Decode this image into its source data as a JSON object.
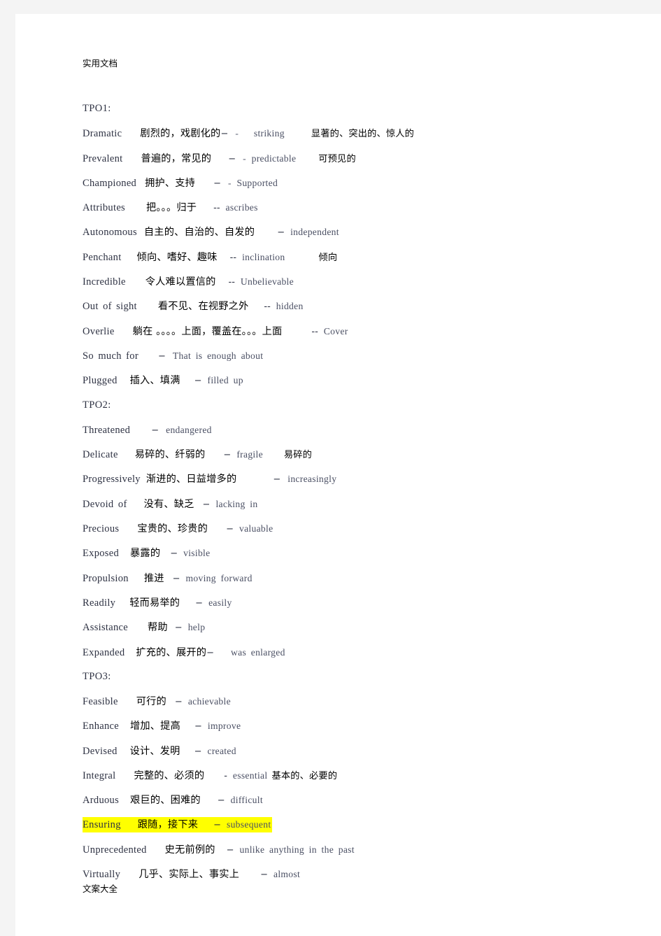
{
  "page": {
    "header_running_text": "实用文档",
    "footer_running_text": "文案大全",
    "background_color": "#f4f4f4",
    "paper_color": "#ffffff",
    "highlight_color": "#ffff00",
    "english_text_color": "#3b3f52",
    "chinese_text_color": "#000000"
  },
  "sections": [
    {
      "label": "TPO1:",
      "entries": [
        {
          "word": "Dramatic",
          "chinese": "剧烈的，戏剧化的",
          "dash": "−",
          "dash2": "-",
          "synonym": "striking",
          "chinese_trailing": "显著的、突出的、惊人的",
          "gap_after_word": 26,
          "gap_after_chinese": 0,
          "gap_after_dash": 22,
          "gap_after_syn": 38,
          "highlighted": false
        },
        {
          "word": "Prevalent",
          "chinese": "普遍的，常见的",
          "dash": "−",
          "dash2": "-",
          "synonym": "predictable",
          "chinese_trailing": "可预见的",
          "gap_after_word": 26,
          "gap_after_chinese": 24,
          "gap_after_dash": 8,
          "gap_after_syn": 32,
          "highlighted": false
        },
        {
          "word": "Championed",
          "chinese": "拥护、支持",
          "dash": "−",
          "dash2": "-",
          "synonym": "Supported",
          "chinese_trailing": "",
          "gap_after_word": 12,
          "gap_after_chinese": 26,
          "gap_after_dash": 8,
          "gap_after_syn": 0,
          "highlighted": false
        },
        {
          "word": "Attributes",
          "chinese": "把。。。归于",
          "dash": "--",
          "dash2": "",
          "synonym": "ascribes",
          "chinese_trailing": "",
          "gap_after_word": 30,
          "gap_after_chinese": 24,
          "gap_after_dash": 8,
          "gap_after_syn": 0,
          "highlighted": false
        },
        {
          "word": "Autonomous",
          "chinese": "自主的、自治的、自发的",
          "dash": "−",
          "dash2": "",
          "synonym": "independent",
          "chinese_trailing": "",
          "gap_after_word": 10,
          "gap_after_chinese": 32,
          "gap_after_dash": 8,
          "gap_after_syn": 0,
          "highlighted": false
        },
        {
          "word": "Penchant",
          "chinese": "倾向、嗜好、趣味",
          "dash": "--",
          "dash2": "",
          "synonym": "inclination",
          "chinese_trailing": "倾向",
          "gap_after_word": 22,
          "gap_after_chinese": 18,
          "gap_after_dash": 8,
          "gap_after_syn": 48,
          "highlighted": false
        },
        {
          "word": "Incredible",
          "chinese": "令人难以置信的",
          "dash": "--",
          "dash2": "",
          "synonym": "Unbelievable",
          "chinese_trailing": "",
          "gap_after_word": 28,
          "gap_after_chinese": 18,
          "gap_after_dash": 8,
          "gap_after_syn": 0,
          "highlighted": false
        },
        {
          "word": "Out of sight",
          "chinese": "看不见、在视野之外",
          "dash": "--",
          "dash2": "",
          "synonym": "hidden",
          "chinese_trailing": "",
          "gap_after_word": 30,
          "gap_after_chinese": 22,
          "gap_after_dash": 8,
          "gap_after_syn": 0,
          "highlighted": false
        },
        {
          "word": "Overlie",
          "chinese": "躺在 。。。。上面，覆盖在。。。上面",
          "dash": "--",
          "dash2": "",
          "synonym": "Cover",
          "chinese_trailing": "",
          "gap_after_word": 26,
          "gap_after_chinese": 42,
          "gap_after_dash": 8,
          "gap_after_syn": 0,
          "highlighted": false
        },
        {
          "word": "So much for",
          "chinese": "",
          "dash": "−",
          "dash2": "",
          "synonym": "That is enough about",
          "chinese_trailing": "",
          "gap_after_word": 28,
          "gap_after_chinese": 0,
          "gap_after_dash": 10,
          "gap_after_syn": 0,
          "highlighted": false
        },
        {
          "word": "Plugged",
          "chinese": "插入、填满",
          "dash": "−",
          "dash2": "",
          "synonym": "filled up",
          "chinese_trailing": "",
          "gap_after_word": 18,
          "gap_after_chinese": 20,
          "gap_after_dash": 8,
          "gap_after_syn": 0,
          "highlighted": false
        }
      ]
    },
    {
      "label": "TPO2:",
      "entries": [
        {
          "word": "Threatened",
          "chinese": "",
          "dash": "−",
          "dash2": "",
          "synonym": "endangered",
          "chinese_trailing": "",
          "gap_after_word": 30,
          "gap_after_chinese": 0,
          "gap_after_dash": 10,
          "gap_after_syn": 0,
          "highlighted": false
        },
        {
          "word": "Delicate",
          "chinese": "易碎的、纤弱的",
          "dash": "−",
          "dash2": "",
          "synonym": "fragile",
          "chinese_trailing": "易碎的",
          "gap_after_word": 24,
          "gap_after_chinese": 26,
          "gap_after_dash": 8,
          "gap_after_syn": 30,
          "highlighted": false
        },
        {
          "word": "Progressively",
          "chinese": "渐进的、日益增多的",
          "dash": "−",
          "dash2": "",
          "synonym": "increasingly",
          "chinese_trailing": "",
          "gap_after_word": 8,
          "gap_after_chinese": 52,
          "gap_after_dash": 10,
          "gap_after_syn": 0,
          "highlighted": false
        },
        {
          "word": "Devoid of",
          "chinese": "没有、缺乏",
          "dash": "−",
          "dash2": "",
          "synonym": "lacking in",
          "chinese_trailing": "",
          "gap_after_word": 24,
          "gap_after_chinese": 12,
          "gap_after_dash": 8,
          "gap_after_syn": 0,
          "highlighted": false
        },
        {
          "word": "Precious",
          "chinese": "宝贵的、珍贵的",
          "dash": "−",
          "dash2": "",
          "synonym": "valuable",
          "chinese_trailing": "",
          "gap_after_word": 26,
          "gap_after_chinese": 26,
          "gap_after_dash": 8,
          "gap_after_syn": 0,
          "highlighted": false
        },
        {
          "word": "Exposed",
          "chinese": "暴露的",
          "dash": "−",
          "dash2": "",
          "synonym": "visible",
          "chinese_trailing": "",
          "gap_after_word": 16,
          "gap_after_chinese": 14,
          "gap_after_dash": 8,
          "gap_after_syn": 0,
          "highlighted": false
        },
        {
          "word": "Propulsion",
          "chinese": "推进",
          "dash": "−",
          "dash2": "",
          "synonym": "moving forward",
          "chinese_trailing": "",
          "gap_after_word": 22,
          "gap_after_chinese": 12,
          "gap_after_dash": 8,
          "gap_after_syn": 0,
          "highlighted": false
        },
        {
          "word": "Readily",
          "chinese": "轻而易举的",
          "dash": "−",
          "dash2": "",
          "synonym": "easily",
          "chinese_trailing": "",
          "gap_after_word": 20,
          "gap_after_chinese": 22,
          "gap_after_dash": 8,
          "gap_after_syn": 0,
          "highlighted": false
        },
        {
          "word": "Assistance",
          "chinese": "帮助",
          "dash": "−",
          "dash2": "",
          "synonym": "help",
          "chinese_trailing": "",
          "gap_after_word": 28,
          "gap_after_chinese": 10,
          "gap_after_dash": 8,
          "gap_after_syn": 0,
          "highlighted": false
        },
        {
          "word": "Expanded",
          "chinese": "扩充的、展开的",
          "dash": "−",
          "dash2": "",
          "synonym": "was enlarged",
          "chinese_trailing": "",
          "gap_after_word": 16,
          "gap_after_chinese": 0,
          "gap_after_dash": 24,
          "gap_after_syn": 0,
          "highlighted": false
        }
      ]
    },
    {
      "label": "TPO3:",
      "entries": [
        {
          "word": "Feasible",
          "chinese": "可行的",
          "dash": "−",
          "dash2": "",
          "synonym": "achievable",
          "chinese_trailing": "",
          "gap_after_word": 26,
          "gap_after_chinese": 12,
          "gap_after_dash": 8,
          "gap_after_syn": 0,
          "highlighted": false
        },
        {
          "word": "Enhance",
          "chinese": "增加、提高",
          "dash": "−",
          "dash2": "",
          "synonym": "improve",
          "chinese_trailing": "",
          "gap_after_word": 16,
          "gap_after_chinese": 20,
          "gap_after_dash": 8,
          "gap_after_syn": 0,
          "highlighted": false
        },
        {
          "word": "Devised",
          "chinese": "设计、发明",
          "dash": "−",
          "dash2": "",
          "synonym": "created",
          "chinese_trailing": "",
          "gap_after_word": 18,
          "gap_after_chinese": 20,
          "gap_after_dash": 8,
          "gap_after_syn": 0,
          "highlighted": false
        },
        {
          "word": "Integral",
          "chinese": "完整的、必须的",
          "dash": "-",
          "dash2": "",
          "synonym": "essential",
          "chinese_trailing": "基本的、必要的",
          "gap_after_word": 26,
          "gap_after_chinese": 28,
          "gap_after_dash": 8,
          "gap_after_syn": 6,
          "highlighted": false
        },
        {
          "word": "Arduous",
          "chinese": "艰巨的、困难的",
          "dash": "−",
          "dash2": "",
          "synonym": "difficult",
          "chinese_trailing": "",
          "gap_after_word": 16,
          "gap_after_chinese": 24,
          "gap_after_dash": 8,
          "gap_after_syn": 0,
          "highlighted": false
        },
        {
          "word": "Ensuring",
          "chinese": "跟随，接下来",
          "dash": "−",
          "dash2": "",
          "synonym": "subsequent",
          "chinese_trailing": "",
          "gap_after_word": 24,
          "gap_after_chinese": 22,
          "gap_after_dash": 8,
          "gap_after_syn": 0,
          "highlighted": true
        },
        {
          "word": "Unprecedented",
          "chinese": "史无前例的",
          "dash": "−",
          "dash2": "",
          "synonym": "unlike anything in the past",
          "chinese_trailing": "",
          "gap_after_word": 26,
          "gap_after_chinese": 16,
          "gap_after_dash": 8,
          "gap_after_syn": 0,
          "highlighted": false
        },
        {
          "word": "Virtually",
          "chinese": "几乎、实际上、事实上",
          "dash": "−",
          "dash2": "",
          "synonym": "almost",
          "chinese_trailing": "",
          "gap_after_word": 26,
          "gap_after_chinese": 30,
          "gap_after_dash": 8,
          "gap_after_syn": 0,
          "highlighted": false
        }
      ]
    }
  ]
}
